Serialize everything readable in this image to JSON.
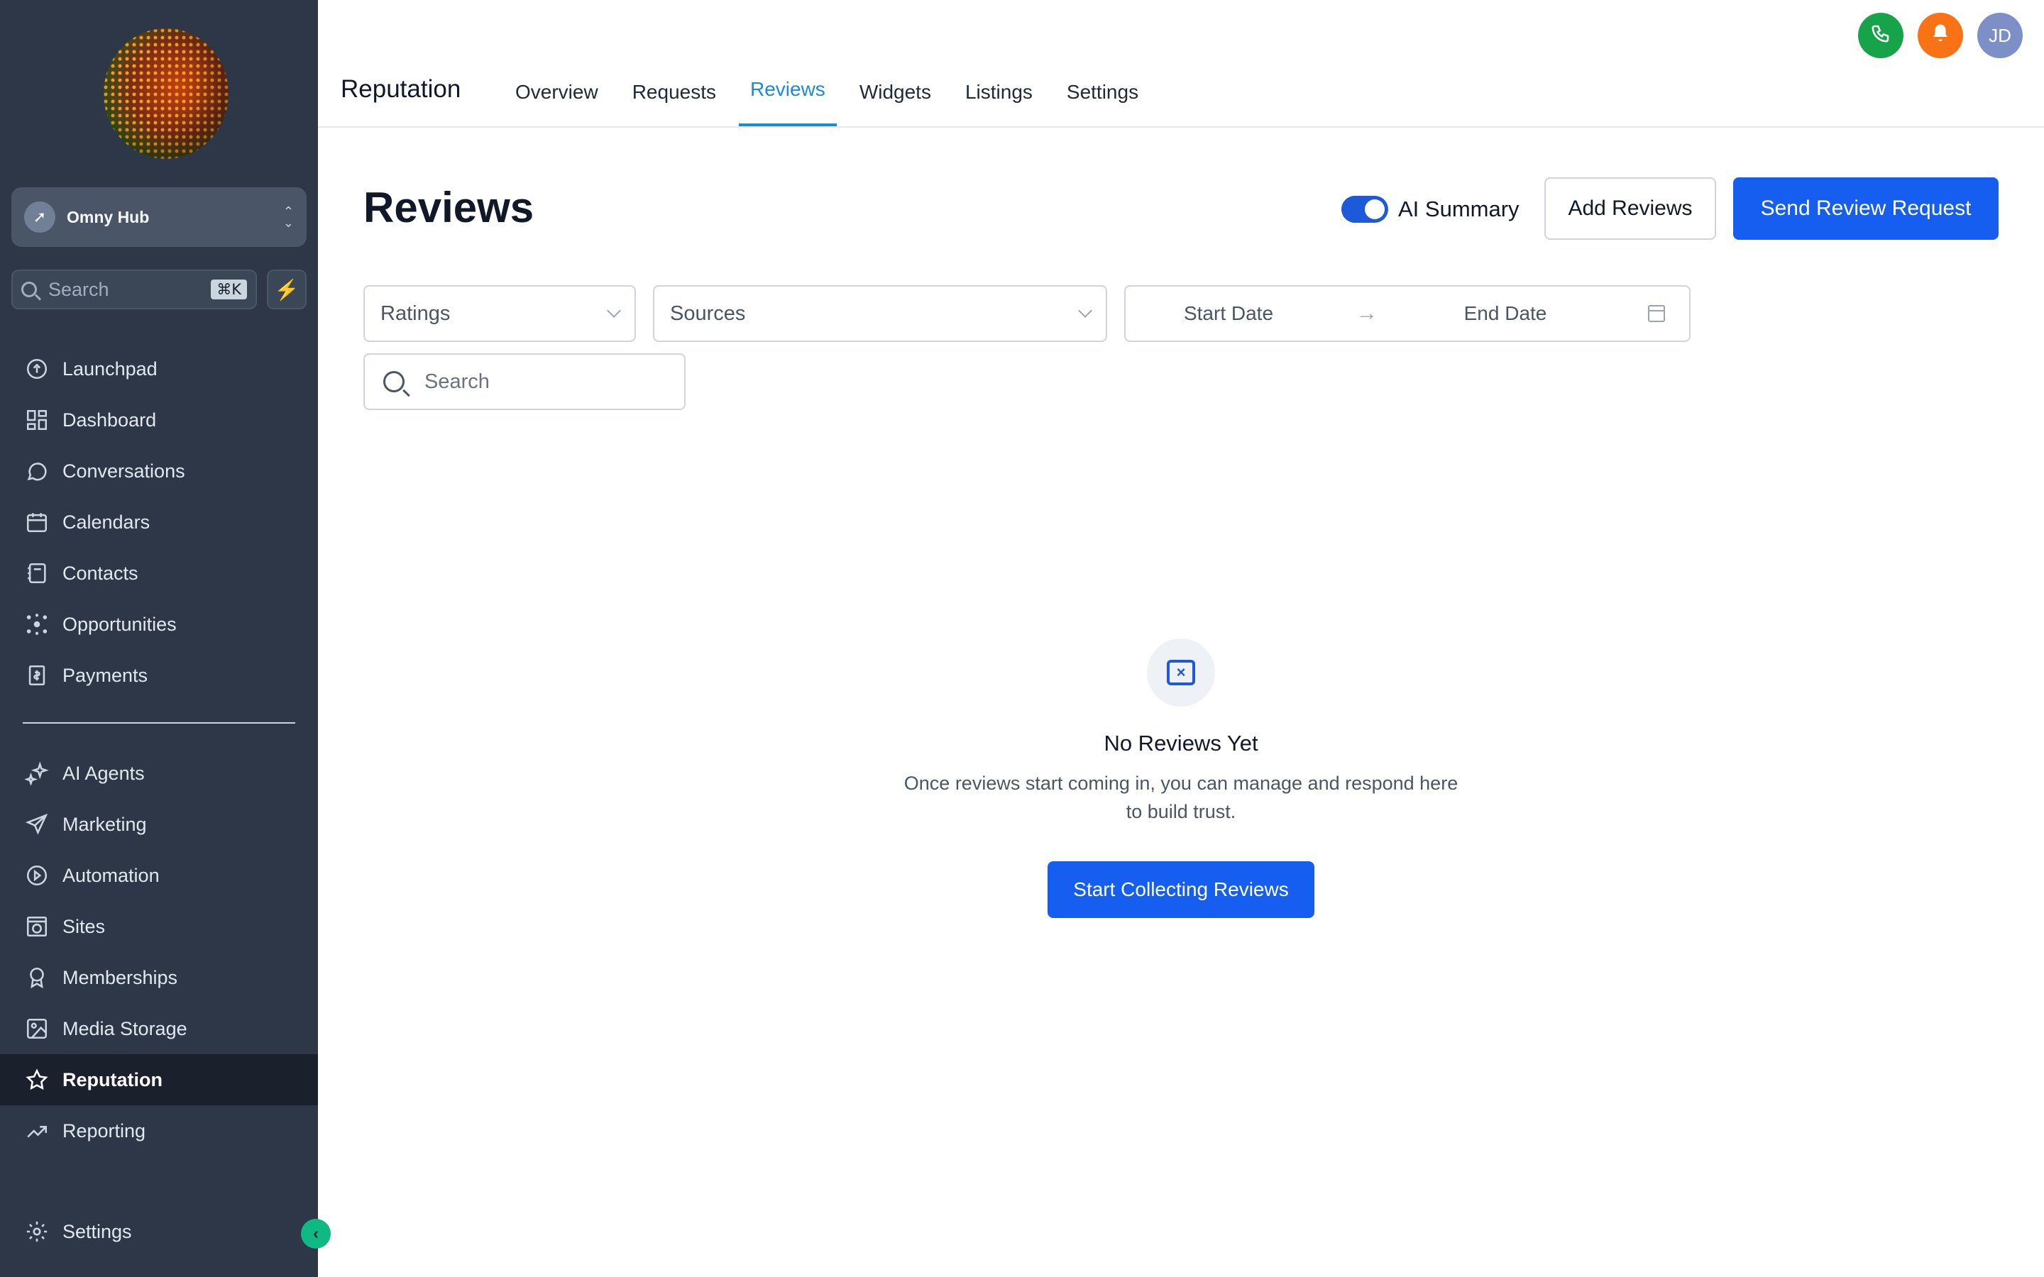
{
  "sidebar": {
    "account_name": "Omny Hub",
    "search_placeholder": "Search",
    "search_shortcut": "⌘K",
    "nav_primary": [
      {
        "label": "Launchpad",
        "icon": "rocket-icon"
      },
      {
        "label": "Dashboard",
        "icon": "grid-icon"
      },
      {
        "label": "Conversations",
        "icon": "chat-icon"
      },
      {
        "label": "Calendars",
        "icon": "calendar-icon"
      },
      {
        "label": "Contacts",
        "icon": "contacts-icon"
      },
      {
        "label": "Opportunities",
        "icon": "network-icon"
      },
      {
        "label": "Payments",
        "icon": "receipt-icon"
      }
    ],
    "nav_secondary": [
      {
        "label": "AI Agents",
        "icon": "sparkles-icon"
      },
      {
        "label": "Marketing",
        "icon": "send-icon"
      },
      {
        "label": "Automation",
        "icon": "play-circle-icon"
      },
      {
        "label": "Sites",
        "icon": "globe-window-icon"
      },
      {
        "label": "Memberships",
        "icon": "badge-icon"
      },
      {
        "label": "Media Storage",
        "icon": "image-icon"
      },
      {
        "label": "Reputation",
        "icon": "star-icon",
        "active": true
      },
      {
        "label": "Reporting",
        "icon": "trend-icon"
      }
    ],
    "settings_label": "Settings"
  },
  "topbar": {
    "app_title": "Reputation",
    "tabs": [
      "Overview",
      "Requests",
      "Reviews",
      "Widgets",
      "Listings",
      "Settings"
    ],
    "active_tab": "Reviews",
    "avatar_initials": "JD"
  },
  "main": {
    "page_title": "Reviews",
    "ai_summary_label": "AI Summary",
    "ai_summary_enabled": true,
    "add_reviews_label": "Add Reviews",
    "send_request_label": "Send Review Request",
    "filters": {
      "ratings_placeholder": "Ratings",
      "sources_placeholder": "Sources",
      "start_date_placeholder": "Start Date",
      "end_date_placeholder": "End Date",
      "search_placeholder": "Search"
    },
    "empty_state": {
      "title": "No Reviews Yet",
      "text": "Once reviews start coming in, you can manage and respond here to build trust.",
      "button_label": "Start Collecting Reviews"
    }
  },
  "colors": {
    "sidebar_bg": "#2d3748",
    "primary": "#155eef",
    "active_tab": "#1d8ad8",
    "phone": "#16a34a",
    "bell": "#f97316",
    "avatar": "#7c8fc6"
  }
}
